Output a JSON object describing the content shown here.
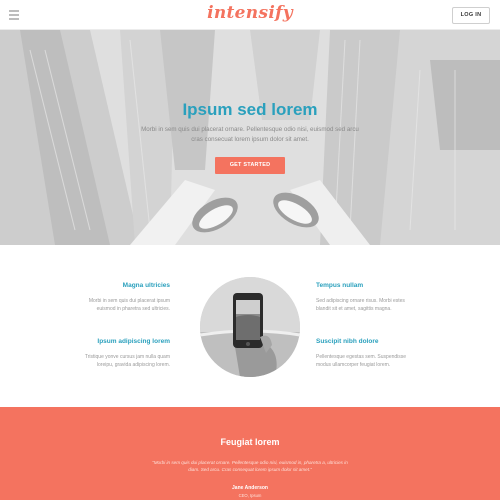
{
  "header": {
    "logo_text": "intensify",
    "login_label": "LOG IN"
  },
  "hero": {
    "title": "Ipsum sed lorem",
    "text": "Morbi in sem quis dui placerat ornare. Pellentesque odio nisi, euismod sed arcu cras consecuat lorem ipsum dolor sit amet.",
    "cta_label": "GET STARTED"
  },
  "features": [
    {
      "title": "Magna ultricies",
      "text": "Morbi in sem quis dui placerat ipsum euismod in pharetra sed ultricies."
    },
    {
      "title": "Tempus nullam",
      "text": "Sed adipiscing ornare risus. Morbi estes blandit sit et amet, sagittis magna."
    },
    {
      "title": "Ipsum adipiscing lorem",
      "text": "Tristique yonve cursus jam nulla quam loreipu, gravida adipiscing lorem."
    },
    {
      "title": "Suscipit nibh dolore",
      "text": "Pellentesque egestas sem. Suspendisse modus ullamcorper feugiat lorem."
    }
  ],
  "footer": {
    "title": "Feugiat lorem",
    "quote": "“Morbi in sem quis dui placerat ornare. Pellentesque odio nisi, euismod in, pharetra a, ultricies in diam. Sed arcu. Cras consequat lorem ipsum dolor sit amet.”",
    "name": "Jane Anderson",
    "role": "CEO, Ipsum"
  },
  "colors": {
    "accent": "#f4735f",
    "heading": "#2aa0bd"
  }
}
